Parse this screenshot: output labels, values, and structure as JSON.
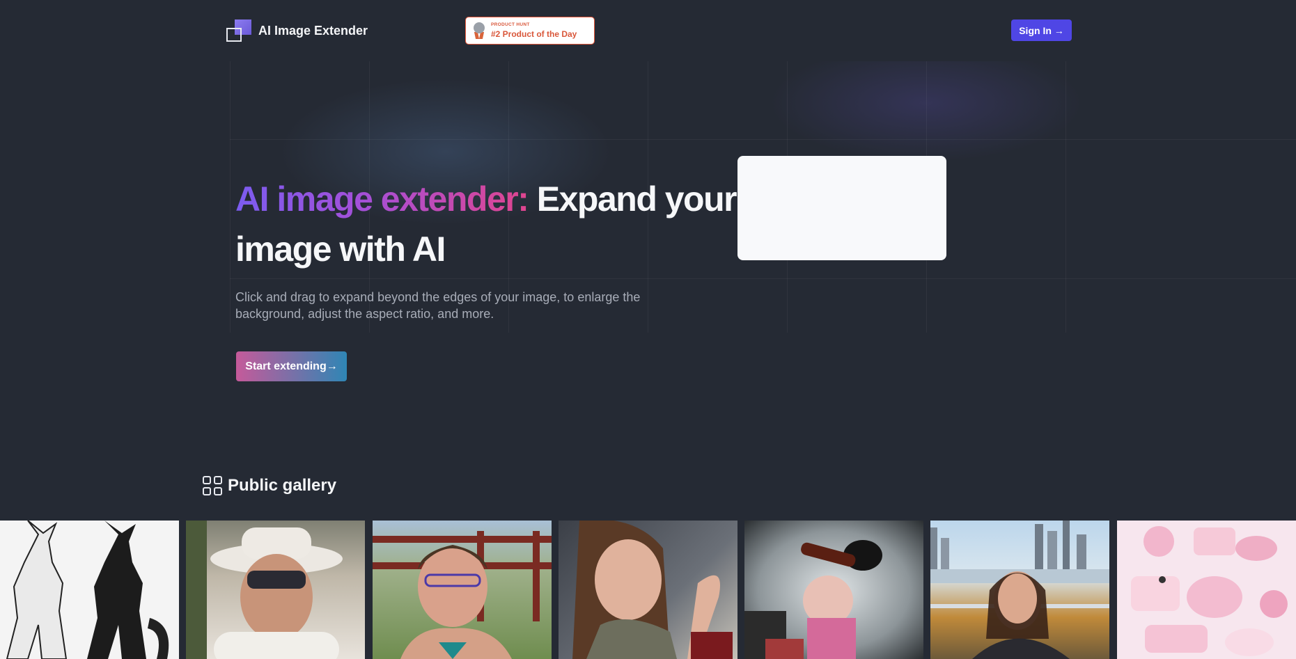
{
  "header": {
    "brand": "AI Image Extender",
    "badge_small": "PRODUCT HUNT",
    "badge_main": "#2 Product of the Day",
    "signin_label": "Sign In →"
  },
  "hero": {
    "headline_gradient": "AI image extender:",
    "headline_rest": " Expand your image with AI",
    "subtext": "Click and drag to expand beyond the edges of your image, to enlarge the background, adjust the aspect ratio, and more.",
    "cta_label": "Start extending→"
  },
  "gallery": {
    "title": "Public gallery",
    "items": [
      {
        "subject": "dragon character sheet"
      },
      {
        "subject": "woman with hat"
      },
      {
        "subject": "woman at fence"
      },
      {
        "subject": "woman selfie"
      },
      {
        "subject": "woman drinking"
      },
      {
        "subject": "woman city skyline"
      },
      {
        "subject": "pink texture sheet"
      }
    ]
  },
  "colors": {
    "background": "#252a34",
    "accent": "#4f46e5",
    "badge": "#d9573a"
  }
}
